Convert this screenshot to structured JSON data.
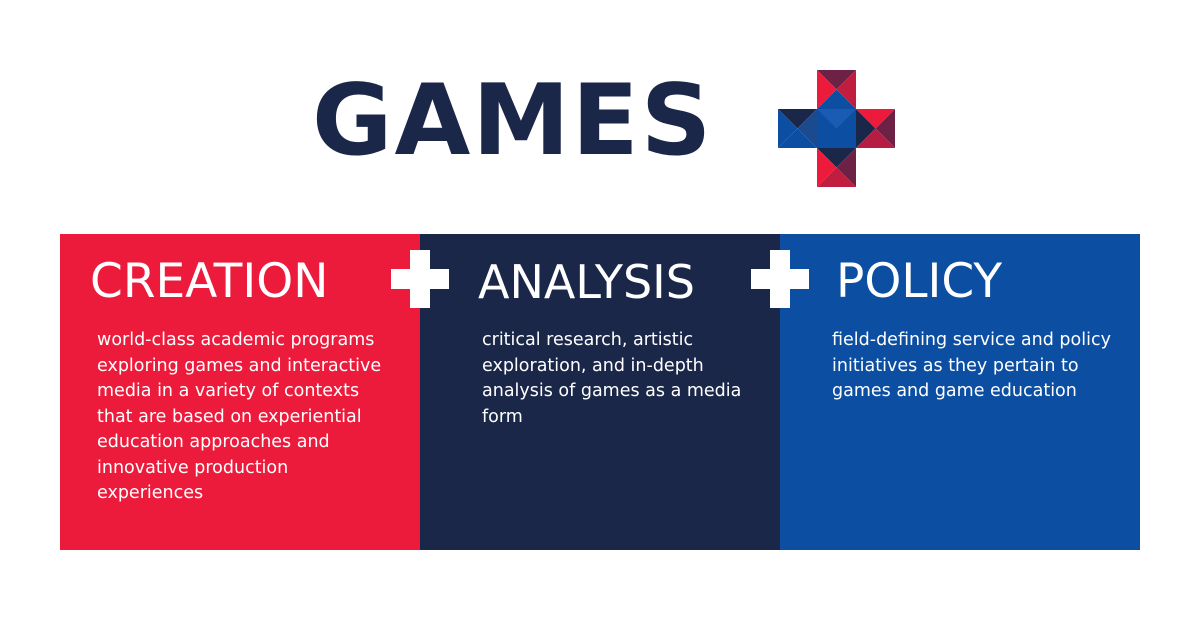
{
  "header": {
    "title": "GAMES",
    "logo_icon": "plus-logo-icon"
  },
  "colors": {
    "navy": "#1b2749",
    "red": "#ec1b3b",
    "blue": "#0b4ea2",
    "white": "#ffffff"
  },
  "separators": [
    {
      "icon": "plus-icon"
    },
    {
      "icon": "plus-icon"
    }
  ],
  "panels": [
    {
      "heading": "CREATION",
      "description": "world-class academic programs exploring games and interactive media in a variety of contexts that are based on experiential education approaches and innovative production experiences",
      "color": "#ec1b3b"
    },
    {
      "heading": "ANALYSIS",
      "description": "critical research, artistic exploration, and in-depth analysis of games as a media form",
      "color": "#1b2749"
    },
    {
      "heading": "POLICY",
      "description": "field-defining service and policy initiatives as they pertain to games and game education",
      "color": "#0b4ea2"
    }
  ]
}
